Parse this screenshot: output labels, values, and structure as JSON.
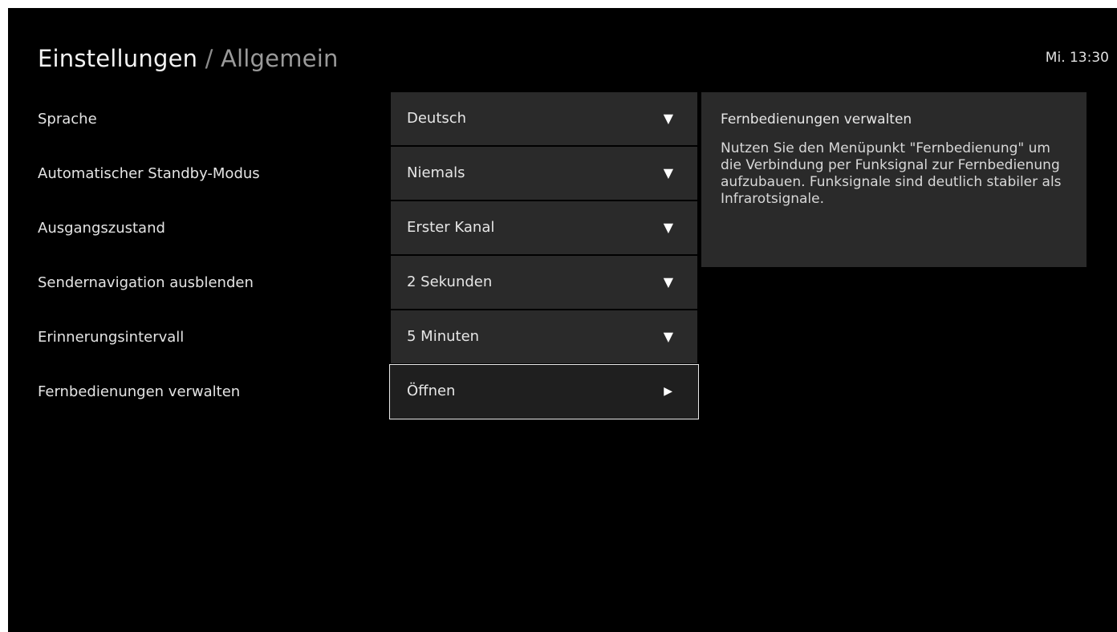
{
  "header": {
    "title": "Einstellungen",
    "separator": " / ",
    "subtitle": "Allgemein",
    "clock": "Mi. 13:30"
  },
  "settings": [
    {
      "label": "Sprache",
      "value": "Deutsch",
      "control_icon": "caret-down-icon",
      "glyph": "▼"
    },
    {
      "label": "Automatischer Standby-Modus",
      "value": "Niemals",
      "control_icon": "caret-down-icon",
      "glyph": "▼"
    },
    {
      "label": "Ausgangszustand",
      "value": "Erster Kanal",
      "control_icon": "caret-down-icon",
      "glyph": "▼"
    },
    {
      "label": "Sendernavigation ausblenden",
      "value": "2 Sekunden",
      "control_icon": "caret-down-icon",
      "glyph": "▼"
    },
    {
      "label": "Erinnerungsintervall",
      "value": "5 Minuten",
      "control_icon": "caret-down-icon",
      "glyph": "▼"
    },
    {
      "label": "Fernbedienungen verwalten",
      "value": "Öffnen",
      "control_icon": "play-arrow-icon",
      "glyph": "▶"
    }
  ],
  "info_panel": {
    "title": "Fernbedienungen verwalten",
    "body": "Nutzen Sie den Menüpunkt \"Fernbedienung\" um die Verbindung per Funksignal zur Fernbedienung aufzubauen. Funksignale sind deutlich stabiler als Infrarotsignale."
  },
  "colors": {
    "background": "#000000",
    "panel": "#2a2a2a",
    "focus_border": "#e8e8e8",
    "text": "#e6e6e6",
    "subtitle": "#9a9a9a"
  }
}
